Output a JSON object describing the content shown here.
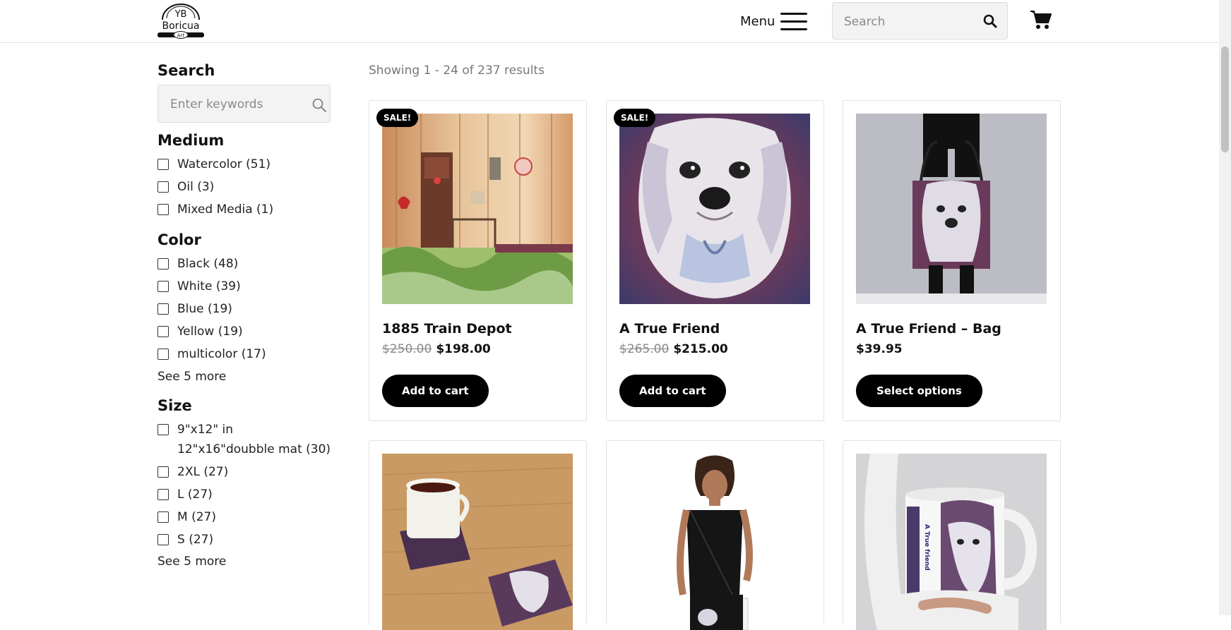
{
  "header": {
    "logo_line1": "YB",
    "logo_line2": "Boricua",
    "logo_line3": "Art",
    "menu_label": "Menu",
    "search_placeholder": "Search"
  },
  "sidebar": {
    "search_heading": "Search",
    "search_placeholder": "Enter keywords",
    "medium": {
      "heading": "Medium",
      "items": [
        "Watercolor (51)",
        "Oil (3)",
        "Mixed Media (1)"
      ]
    },
    "color": {
      "heading": "Color",
      "items": [
        "Black (48)",
        "White (39)",
        "Blue (19)",
        "Yellow (19)",
        "multicolor (17)"
      ],
      "see_more": "See 5 more"
    },
    "size": {
      "heading": "Size",
      "items": [
        "9\"x12\" in 12\"x16\"doubble mat (30)",
        "2XL (27)",
        "L (27)",
        "M (27)",
        "S (27)"
      ],
      "see_more": "See 5 more"
    }
  },
  "results": {
    "count_text": "Showing 1 - 24 of 237 results"
  },
  "products": [
    {
      "sale_badge": "SALE!",
      "title": "1885 Train Depot",
      "old_price": "$250.00",
      "price": "$198.00",
      "cta": "Add to cart"
    },
    {
      "sale_badge": "SALE!",
      "title": "A True Friend",
      "old_price": "$265.00",
      "price": "$215.00",
      "cta": "Add to cart"
    },
    {
      "title": "A True Friend – Bag",
      "price": "$39.95",
      "cta": "Select options"
    }
  ],
  "mug_text": "A True friend"
}
